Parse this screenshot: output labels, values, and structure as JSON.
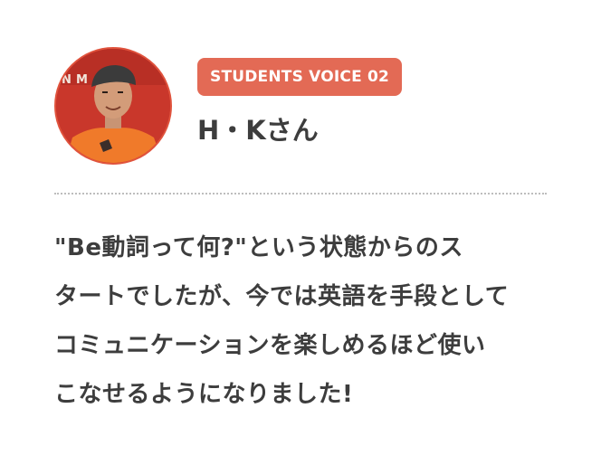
{
  "badge": {
    "label": "STUDENTS VOICE 02"
  },
  "student": {
    "name": "H・Kさん"
  },
  "quote": {
    "lines": [
      "\"Be動詞って何?\"という状態からのス",
      "タートでしたが、今では英語を手段として",
      "コミュニケーションを楽しめるほど使い",
      "こなせるようになりました!"
    ]
  },
  "colors": {
    "accent": "#e36a55",
    "text": "#3d3d3d",
    "divider": "#bdbdbd",
    "avatar_bg": "#c9372b",
    "avatar_shirt": "#f07a2a"
  },
  "icons": {
    "avatar": "student-photo"
  }
}
